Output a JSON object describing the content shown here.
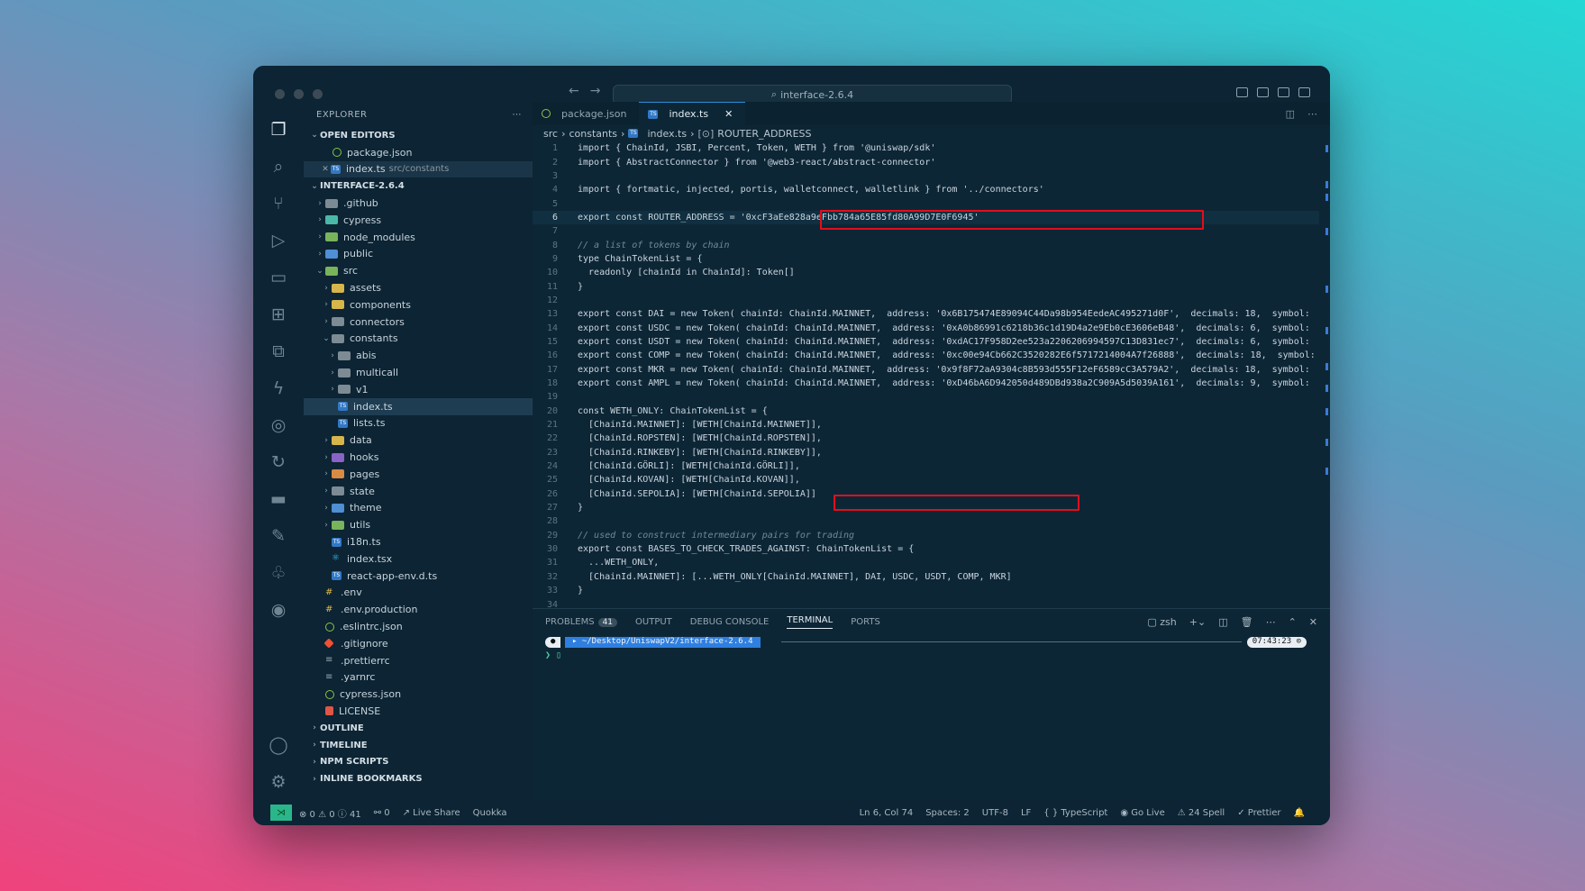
{
  "window": {
    "search_text": "interface-2.6.4"
  },
  "explorer": {
    "title": "EXPLORER",
    "more": "⋯",
    "open_editors_title": "OPEN EDITORS",
    "open_editors": [
      {
        "name": "package.json",
        "path": ""
      },
      {
        "name": "index.ts",
        "path": "src/constants"
      }
    ],
    "project_title": "INTERFACE-2.6.4",
    "tree": [
      {
        "label": ".github",
        "depth": 0,
        "kind": "folder",
        "color": "gray",
        "chev": "›"
      },
      {
        "label": "cypress",
        "depth": 0,
        "kind": "folder",
        "color": "teal",
        "chev": "›"
      },
      {
        "label": "node_modules",
        "depth": 0,
        "kind": "folder",
        "color": "green",
        "chev": "›"
      },
      {
        "label": "public",
        "depth": 0,
        "kind": "folder",
        "color": "blue",
        "chev": "›"
      },
      {
        "label": "src",
        "depth": 0,
        "kind": "folder",
        "color": "green",
        "chev": "⌄"
      },
      {
        "label": "assets",
        "depth": 1,
        "kind": "folder",
        "color": "yellow",
        "chev": "›"
      },
      {
        "label": "components",
        "depth": 1,
        "kind": "folder",
        "color": "yellow",
        "chev": "›"
      },
      {
        "label": "connectors",
        "depth": 1,
        "kind": "folder",
        "color": "gray",
        "chev": "›"
      },
      {
        "label": "constants",
        "depth": 1,
        "kind": "folder",
        "color": "gray",
        "chev": "⌄"
      },
      {
        "label": "abis",
        "depth": 2,
        "kind": "folder",
        "color": "gray",
        "chev": "›"
      },
      {
        "label": "multicall",
        "depth": 2,
        "kind": "folder",
        "color": "gray",
        "chev": "›"
      },
      {
        "label": "v1",
        "depth": 2,
        "kind": "folder",
        "color": "gray",
        "chev": "›"
      },
      {
        "label": "index.ts",
        "depth": 2,
        "kind": "ts",
        "chev": ""
      },
      {
        "label": "lists.ts",
        "depth": 2,
        "kind": "ts",
        "chev": ""
      },
      {
        "label": "data",
        "depth": 1,
        "kind": "folder",
        "color": "yellow",
        "chev": "›"
      },
      {
        "label": "hooks",
        "depth": 1,
        "kind": "folder",
        "color": "purple",
        "chev": "›"
      },
      {
        "label": "pages",
        "depth": 1,
        "kind": "folder",
        "color": "orange",
        "chev": "›"
      },
      {
        "label": "state",
        "depth": 1,
        "kind": "folder",
        "color": "gray",
        "chev": "›"
      },
      {
        "label": "theme",
        "depth": 1,
        "kind": "folder",
        "color": "blue",
        "chev": "›"
      },
      {
        "label": "utils",
        "depth": 1,
        "kind": "folder",
        "color": "green",
        "chev": "›"
      },
      {
        "label": "i18n.ts",
        "depth": 1,
        "kind": "ts",
        "chev": ""
      },
      {
        "label": "index.tsx",
        "depth": 1,
        "kind": "react",
        "chev": ""
      },
      {
        "label": "react-app-env.d.ts",
        "depth": 1,
        "kind": "ts",
        "chev": ""
      },
      {
        "label": ".env",
        "depth": 0,
        "kind": "env",
        "chev": ""
      },
      {
        "label": ".env.production",
        "depth": 0,
        "kind": "env",
        "chev": ""
      },
      {
        "label": ".eslintrc.json",
        "depth": 0,
        "kind": "json",
        "chev": ""
      },
      {
        "label": ".gitignore",
        "depth": 0,
        "kind": "git",
        "chev": ""
      },
      {
        "label": ".prettierrc",
        "depth": 0,
        "kind": "gen",
        "chev": ""
      },
      {
        "label": ".yarnrc",
        "depth": 0,
        "kind": "gen",
        "chev": ""
      },
      {
        "label": "cypress.json",
        "depth": 0,
        "kind": "json",
        "chev": ""
      },
      {
        "label": "LICENSE",
        "depth": 0,
        "kind": "lic",
        "chev": ""
      }
    ],
    "footer_sections": [
      "OUTLINE",
      "TIMELINE",
      "NPM SCRIPTS",
      "INLINE BOOKMARKS"
    ]
  },
  "tabs": [
    {
      "label": "package.json",
      "active": false
    },
    {
      "label": "index.ts",
      "active": true
    }
  ],
  "breadcrumb": [
    "src",
    "constants",
    "index.ts",
    "ROUTER_ADDRESS"
  ],
  "code_lines": [
    "import { ChainId, JSBI, Percent, Token, WETH } from '@uniswap/sdk'",
    "import { AbstractConnector } from '@web3-react/abstract-connector'",
    "",
    "import { fortmatic, injected, portis, walletconnect, walletlink } from '../connectors'",
    "",
    "export const ROUTER_ADDRESS = '0xcF3aEe828a9eFbb784a65E85fd80A99D7E0F6945'",
    "",
    "// a list of tokens by chain",
    "type ChainTokenList = {",
    "  readonly [chainId in ChainId]: Token[]",
    "}",
    "",
    "export const DAI = new Token( chainId: ChainId.MAINNET,  address: '0x6B175474E89094C44Da98b954EedeAC495271d0F',  decimals: 18,  symbol:",
    "export const USDC = new Token( chainId: ChainId.MAINNET,  address: '0xA0b86991c6218b36c1d19D4a2e9Eb0cE3606eB48',  decimals: 6,  symbol:",
    "export const USDT = new Token( chainId: ChainId.MAINNET,  address: '0xdAC17F958D2ee523a2206206994597C13D831ec7',  decimals: 6,  symbol:",
    "export const COMP = new Token( chainId: ChainId.MAINNET,  address: '0xc00e94Cb662C3520282E6f5717214004A7f26888',  decimals: 18,  symbol:",
    "export const MKR = new Token( chainId: ChainId.MAINNET,  address: '0x9f8F72aA9304c8B593d555F12eF6589cC3A579A2',  decimals: 18,  symbol:",
    "export const AMPL = new Token( chainId: ChainId.MAINNET,  address: '0xD46bA6D942050d489DBd938a2C909A5d5039A161',  decimals: 9,  symbol:",
    "",
    "const WETH_ONLY: ChainTokenList = {",
    "  [ChainId.MAINNET]: [WETH[ChainId.MAINNET]],",
    "  [ChainId.ROPSTEN]: [WETH[ChainId.ROPSTEN]],",
    "  [ChainId.RINKEBY]: [WETH[ChainId.RINKEBY]],",
    "  [ChainId.GÖRLI]: [WETH[ChainId.GÖRLI]],",
    "  [ChainId.KOVAN]: [WETH[ChainId.KOVAN]],",
    "  [ChainId.SEPOLIA]: [WETH[ChainId.SEPOLIA]]",
    "}",
    "",
    "// used to construct intermediary pairs for trading",
    "export const BASES_TO_CHECK_TRADES_AGAINST: ChainTokenList = {",
    "  ...WETH_ONLY,",
    "  [ChainId.MAINNET]: [...WETH_ONLY[ChainId.MAINNET], DAI, USDC, USDT, COMP, MKR]",
    "}",
    "",
    "/**"
  ],
  "panel": {
    "tabs": [
      "PROBLEMS",
      "OUTPUT",
      "DEBUG CONSOLE",
      "TERMINAL",
      "PORTS"
    ],
    "problems_count": "41",
    "active_tab": "TERMINAL",
    "shell": "zsh",
    "prompt_path": "~/Desktop/UniswapV2/interface-2.6.4",
    "prompt_time": "07:43:23",
    "prompt_cursor": "❯"
  },
  "statusbar": {
    "problems": "⊗ 0 ⚠ 0 ⓘ 41",
    "ports": "⚯ 0",
    "live_share": "Live Share",
    "quokka": "Quokka",
    "position": "Ln 6, Col 74",
    "spaces": "Spaces: 2",
    "encoding": "UTF-8",
    "eol": "LF",
    "language": "TypeScript",
    "go_live": "Go Live",
    "spell": "24 Spell",
    "prettier": "✓ Prettier"
  },
  "colors": {
    "window_bg": "#0c2433",
    "highlight_box": "#e00f1c",
    "accent": "#2e8fd8",
    "remote": "#2bb58b"
  }
}
